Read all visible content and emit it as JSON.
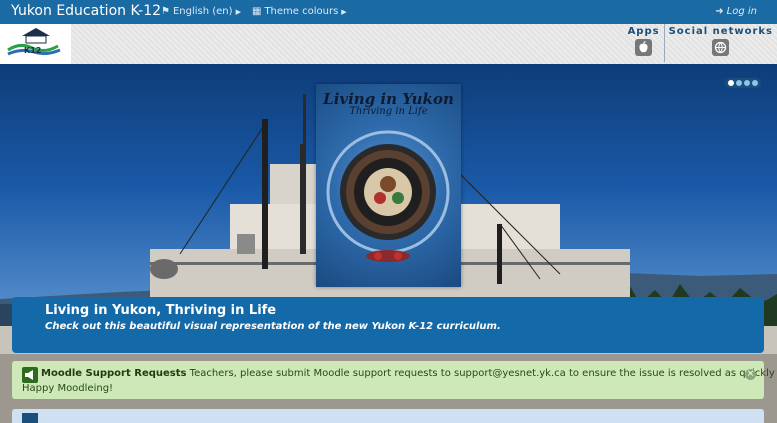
{
  "navbar": {
    "brand": "Yukon Education K-12",
    "language": "English (en)",
    "theme": "Theme colours",
    "login": "Log in"
  },
  "header": {
    "apps_title": "Apps",
    "social_title": "Social networks",
    "apps_icon": "apple-icon",
    "social_icon": "globe-icon"
  },
  "carousel": {
    "slide_count": 4,
    "active_slide": 1,
    "poster": {
      "title": "Living in Yukon",
      "subtitle": "Thriving in Life"
    },
    "caption_title": "Living in Yukon, Thriving in Life",
    "caption_text": "Check out this beautiful visual representation of the new Yukon K-12 curriculum."
  },
  "alert": {
    "title": "Moodle Support Requests",
    "message": "Teachers, please submit Moodle support requests to support@yesnet.yk.ca to ensure the issue is resolved as quickly as possible.",
    "signoff": "Happy Moodleing!"
  },
  "colors": {
    "navbar": "#1a6aa3",
    "caption": "#1469a8",
    "alert_bg": "#cfe8b8"
  }
}
